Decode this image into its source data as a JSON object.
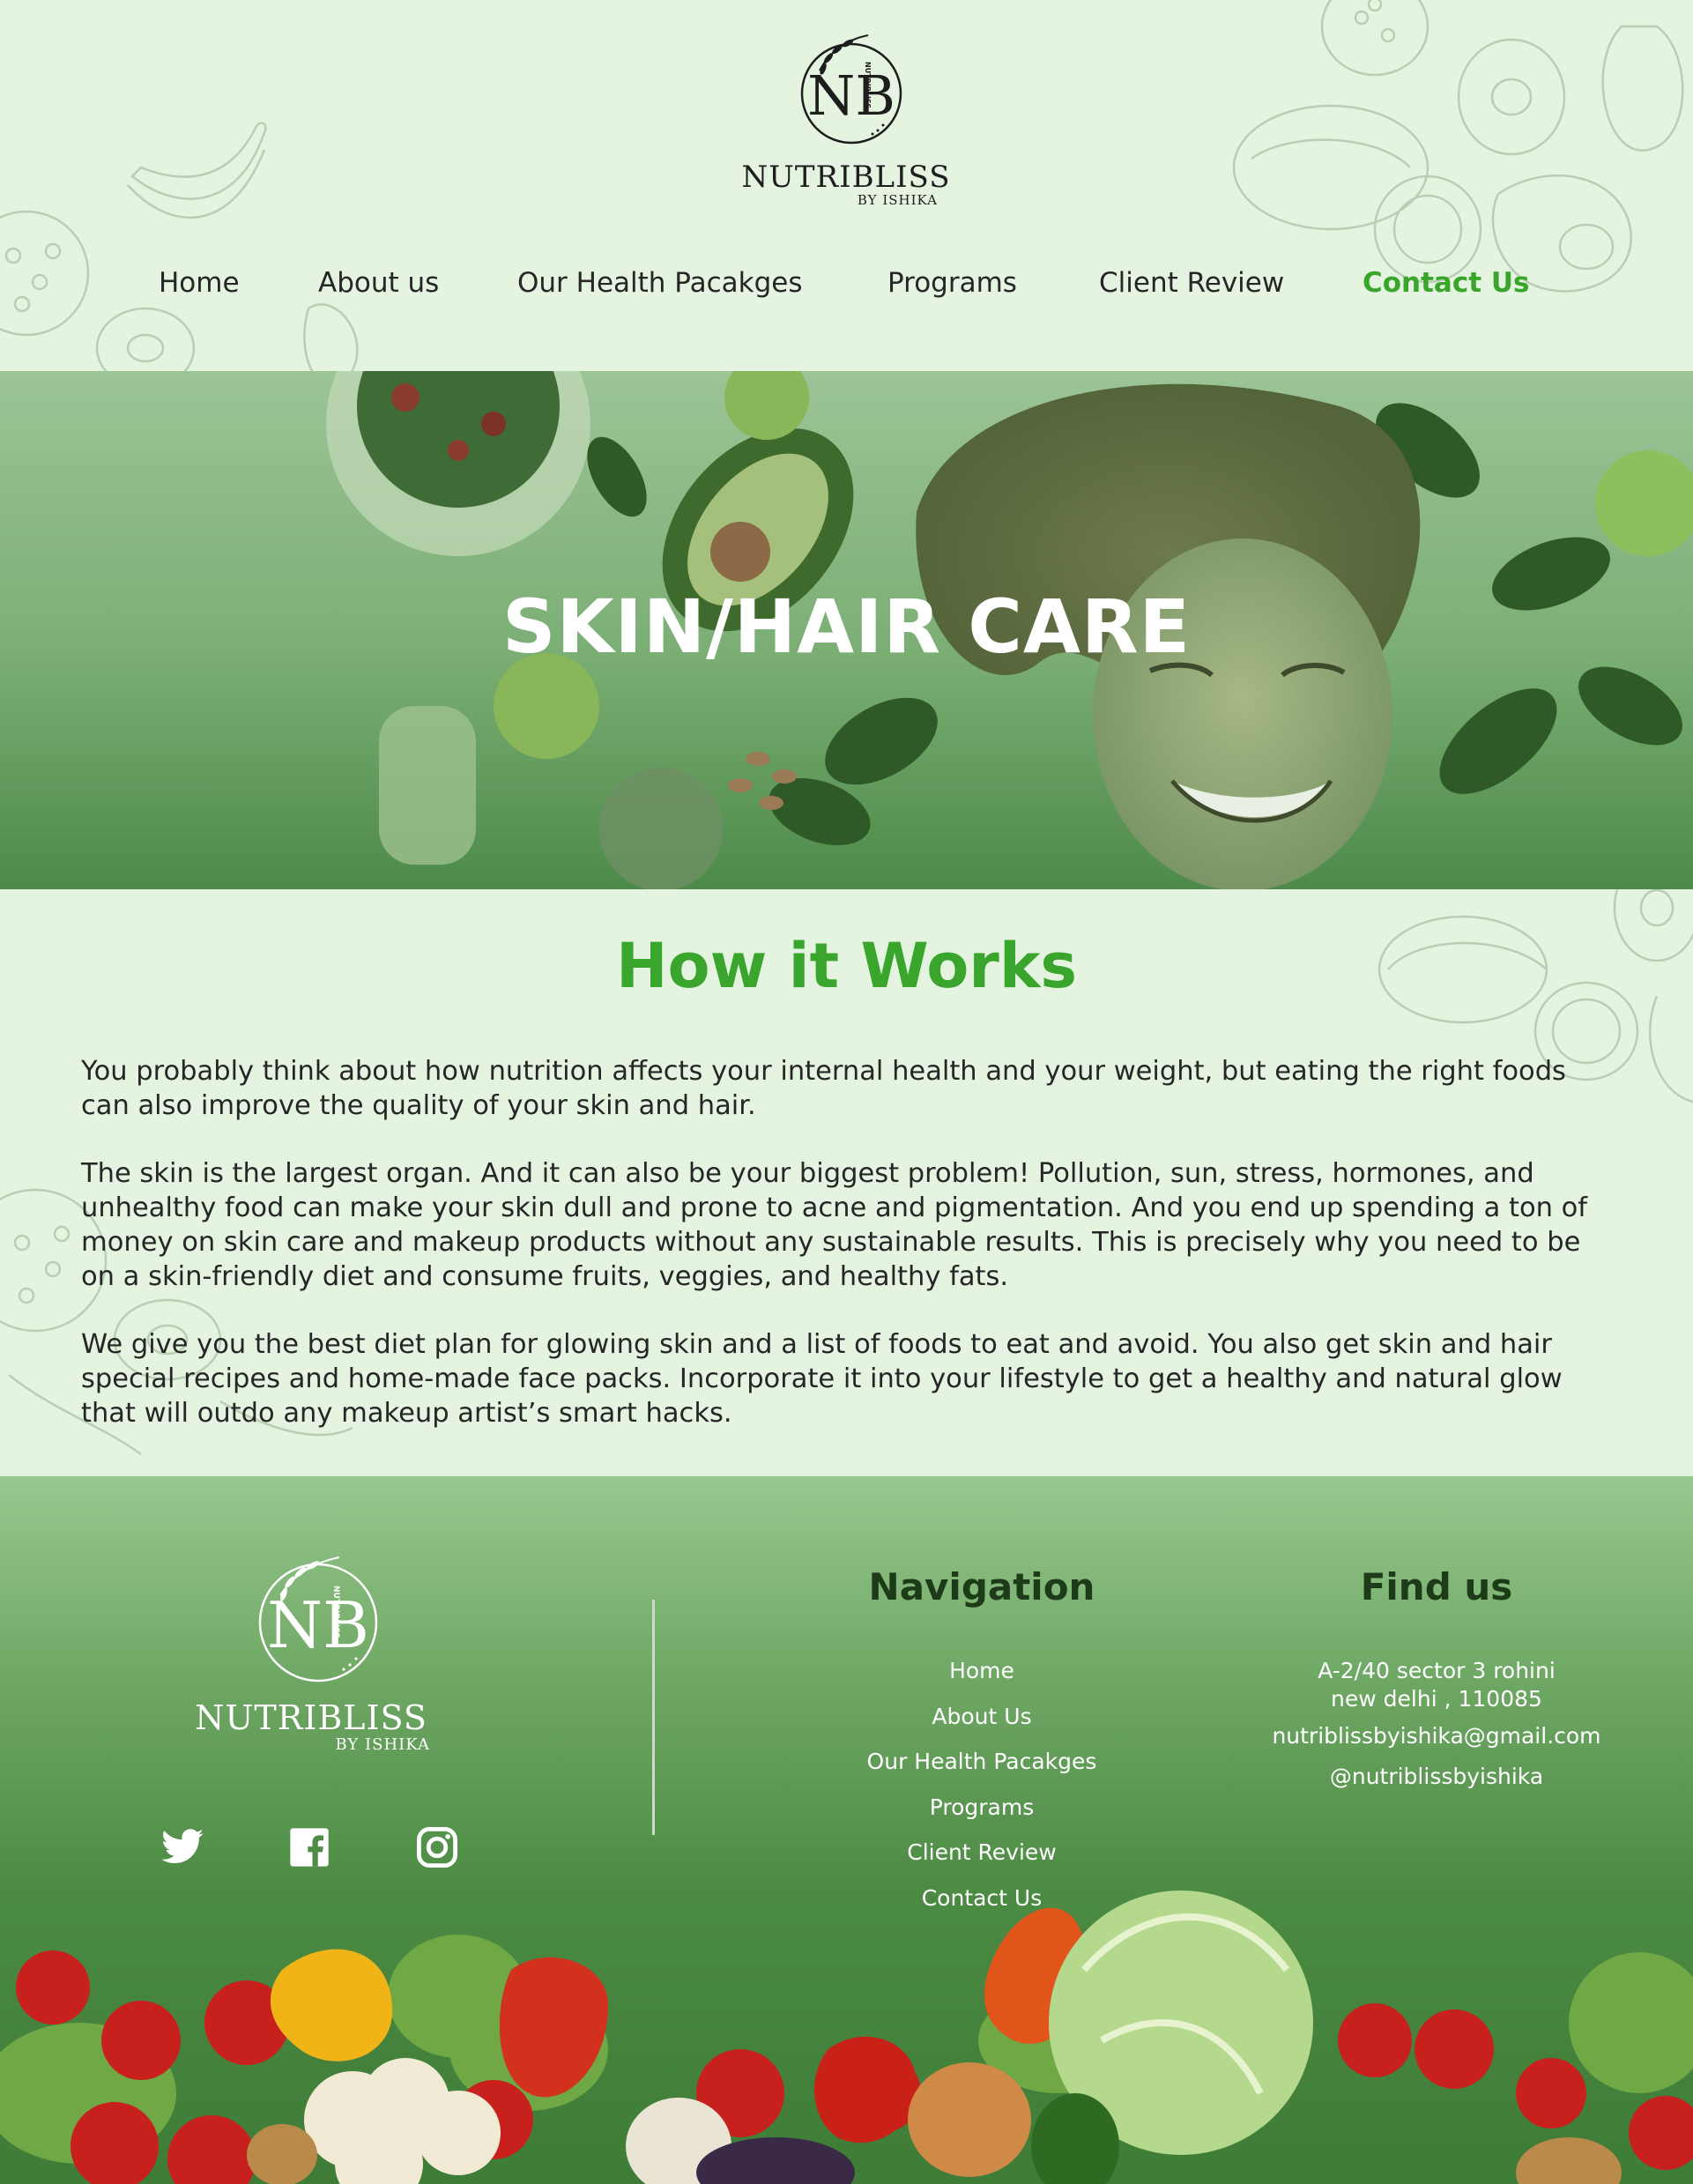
{
  "brand": {
    "name": "NUTRIBLISS",
    "sub": "BY ISHIKA",
    "monogram": "NB",
    "mini_text": "NUTRIBLISS"
  },
  "nav": {
    "items": [
      {
        "label": "Home"
      },
      {
        "label": "About us"
      },
      {
        "label": "Our Health Pacakges"
      },
      {
        "label": "Programs"
      },
      {
        "label": "Client Review"
      },
      {
        "label": "Contact Us",
        "active": true
      }
    ]
  },
  "hero": {
    "title": "SKIN/HAIR CARE"
  },
  "how": {
    "title": "How it Works",
    "paragraphs": [
      "You probably think about how nutrition affects your internal health and your weight, but eating the right foods can also improve the quality of your skin and hair.",
      "The skin is the largest organ. And it can also be your biggest problem! Pollution, sun, stress, hormones, and unhealthy food can make your skin dull and prone to acne and pigmentation. And you end up spending a ton of money on skin care and makeup products without any sustainable results. This is precisely why you need to be on a skin-friendly diet and consume fruits, veggies, and healthy fats.",
      "We give you the best diet plan for glowing skin and a list of foods to eat and avoid. You also get skin and hair special recipes and home-made face packs. Incorporate it into your lifestyle to get a healthy and natural glow that will outdo any makeup artist’s smart hacks."
    ]
  },
  "footer": {
    "social": [
      {
        "icon": "twitter-icon"
      },
      {
        "icon": "facebook-icon"
      },
      {
        "icon": "instagram-icon"
      }
    ],
    "navigation": {
      "title": "Navigation",
      "links": [
        "Home",
        "About Us",
        "Our Health Pacakges",
        "Programs",
        "Client Review",
        "Contact Us"
      ]
    },
    "find": {
      "title": "Find us",
      "address": "A-2/40 sector 3 rohini new delhi , 110085",
      "email": "nutriblissbyishika@gmail.com",
      "handle": "@nutriblissbyishika"
    }
  },
  "colors": {
    "page_bg": "#e4f4e0",
    "accent_green": "#3aa52c",
    "footer_green": "#4b8a43",
    "heading_dark": "#1d3b18"
  }
}
